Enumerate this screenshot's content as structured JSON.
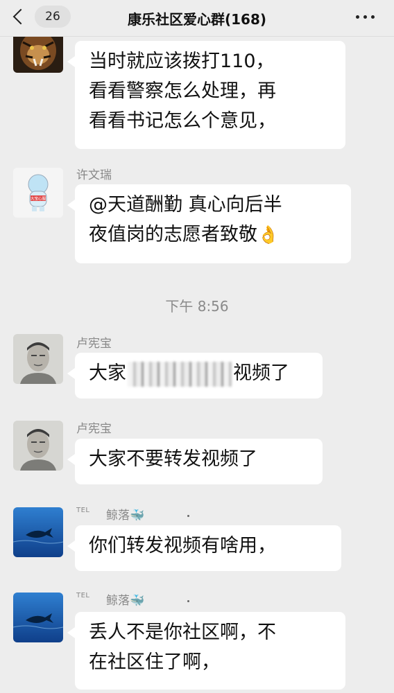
{
  "header": {
    "back_count": "26",
    "title": "康乐社区爱心群(168)"
  },
  "messages": [
    {
      "sender": "",
      "lines": [
        "当时就应该拨打110，",
        "看看警察怎么处理，再",
        "看看书记怎么个意见，"
      ]
    },
    {
      "sender": "许文瑞",
      "avatar_text": "大宝心服",
      "lines": [
        "@天道酬勤 真心向后半",
        "夜值岗的志愿者致敬"
      ],
      "emoji": "👌"
    },
    {
      "sender": "卢宪宝",
      "text_before": "大家",
      "text_after": "视频了"
    },
    {
      "sender": "卢宪宝",
      "lines": [
        "大家不要转发视频了"
      ]
    },
    {
      "sender_prefix": "TEL",
      "sender": "鲸落🐳",
      "lines": [
        "你们转发视频有啥用，"
      ]
    },
    {
      "sender_prefix": "TEL",
      "sender": "鲸落🐳",
      "lines": [
        "丢人不是你社区啊，不",
        "在社区住了啊，"
      ]
    }
  ],
  "timestamp": "下午 8:56",
  "icons": {
    "back": "chevron-left-icon",
    "more": "more-horizontal-icon"
  }
}
